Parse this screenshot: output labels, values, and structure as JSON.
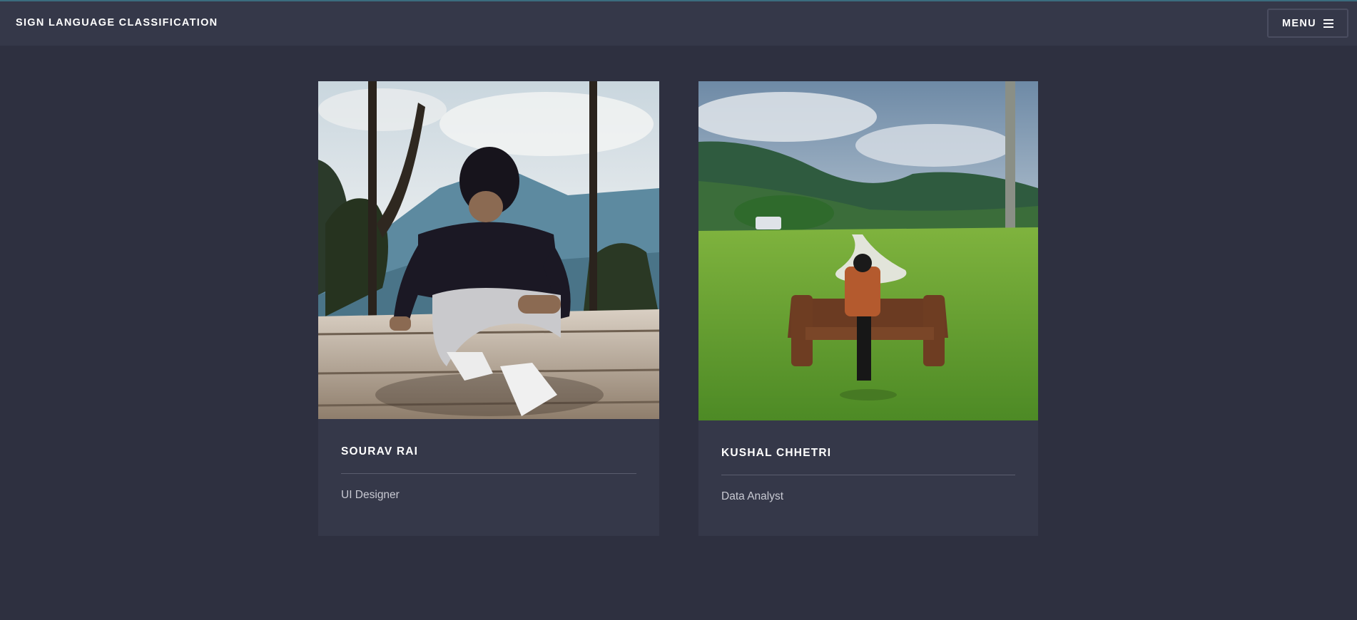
{
  "header": {
    "title": "SIGN LANGUAGE CLASSIFICATION",
    "menu_label": "MENU",
    "menu_icon": "hamburger-icon"
  },
  "team": [
    {
      "name": "SOURAV RAI",
      "role": "UI Designer",
      "photo": "person-sitting-on-wooden-deck-mountains"
    },
    {
      "name": "KUSHAL CHHETRI",
      "role": "Data Analyst",
      "photo": "person-sitting-on-bench-in-park"
    }
  ],
  "colors": {
    "page_bg": "#2e3040",
    "header_bg": "#353849",
    "card_bg": "#353849",
    "text": "#ffffff",
    "muted_text": "#c8c9d2"
  }
}
